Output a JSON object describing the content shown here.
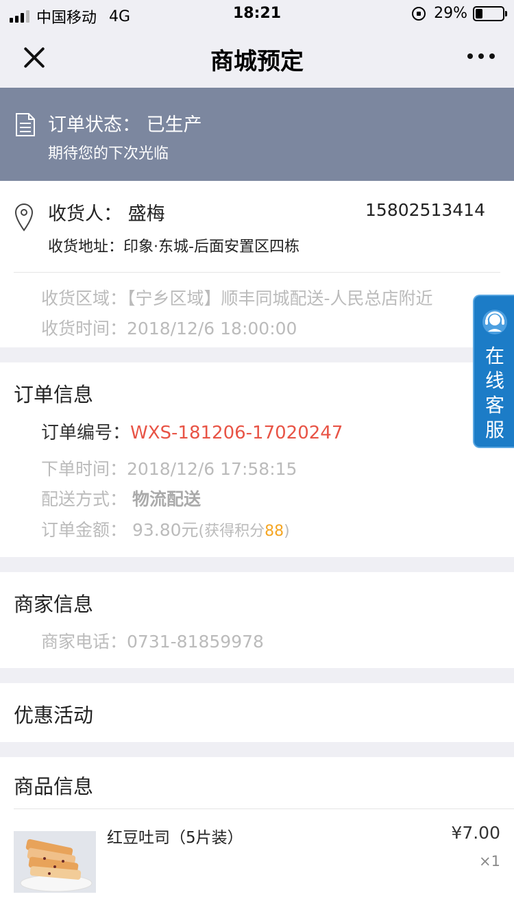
{
  "status_bar": {
    "carrier": "中国移动",
    "network": "4G",
    "time": "18:21",
    "battery": "29%"
  },
  "nav": {
    "title": "商城预定"
  },
  "order_status": {
    "label": "订单状态：",
    "value": "已生产",
    "message": "期待您的下次光临"
  },
  "address": {
    "receiver_label": "收货人：",
    "receiver_name": "盛梅",
    "phone": "15802513414",
    "address_label": "收货地址：",
    "address_value": "印象·东城-后面安置区四栋",
    "region_label": "收货区域：",
    "region_value": "【宁乡区域】顺丰同城配送-人民总店附近",
    "delivery_time_label": "收货时间：",
    "delivery_time_value": "2018/12/6 18:00:00"
  },
  "order_info": {
    "title": "订单信息",
    "order_no_label": "订单编号：",
    "order_no": "WXS-181206-17020247",
    "order_time_label": "下单时间：",
    "order_time": "2018/12/6 17:58:15",
    "shipping_label": "配送方式：",
    "shipping_value": "物流配送",
    "amount_label": "订单金额：",
    "amount_value": "93.80元",
    "points_prefix": "(获得积分",
    "points": "88",
    "points_suffix": ")"
  },
  "merchant": {
    "title": "商家信息",
    "phone_label": "商家电话：",
    "phone": "0731-81859978"
  },
  "promotions": {
    "title": "优惠活动"
  },
  "goods": {
    "title": "商品信息",
    "items": [
      {
        "name": "红豆吐司（5片装）",
        "price": "¥7.00",
        "qty": "×1"
      }
    ]
  },
  "service": {
    "label": "在线客服"
  },
  "colors": {
    "banner": "#7c879f",
    "order_no": "#e85446",
    "points": "#f5a623",
    "service": "#1c7cc7"
  }
}
